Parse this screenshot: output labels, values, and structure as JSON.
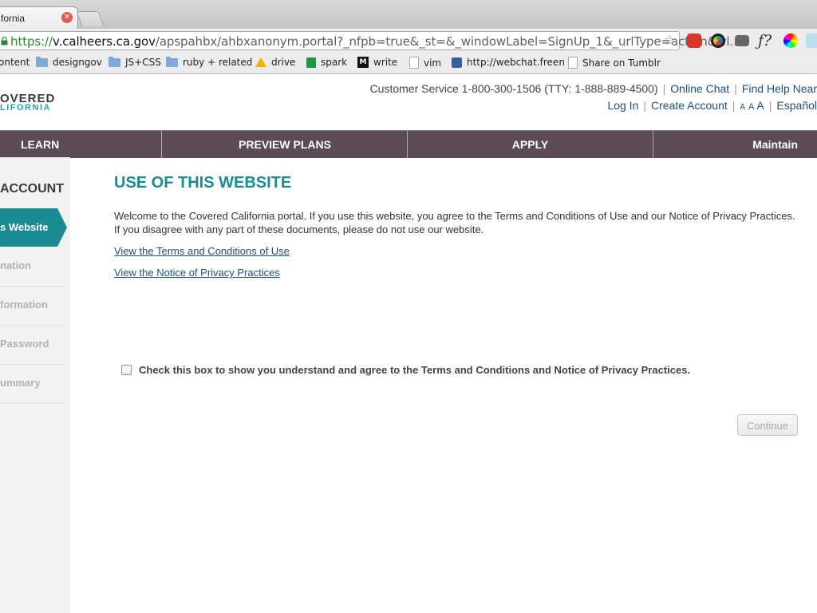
{
  "browser": {
    "tab_title": "fornia",
    "url_scheme": "https://",
    "url_host": "v.calheers.ca.gov",
    "url_rest": "/apspahbx/ahbxanonym.portal?_nfpb=true&_st=&_windowLabel=SignUp_1&_urlType=action&wl...",
    "bookmarks": [
      {
        "label": "ontent",
        "icon": "page-icon"
      },
      {
        "label": "designgov",
        "icon": "folder-icon"
      },
      {
        "label": "JS+CSS",
        "icon": "folder-icon"
      },
      {
        "label": "ruby + related",
        "icon": "folder-icon"
      },
      {
        "label": "drive",
        "icon": "drive-icon"
      },
      {
        "label": "spark",
        "icon": "sheet-icon"
      },
      {
        "label": "write",
        "icon": "medium-icon"
      },
      {
        "label": "vim",
        "icon": "page-icon"
      },
      {
        "label": "http://webchat.freen",
        "icon": "chat-icon"
      },
      {
        "label": "Share on Tumblr",
        "icon": "page-icon"
      }
    ]
  },
  "header": {
    "logo_line1": "OVERED",
    "logo_line2": "LIFORNIA",
    "customer_service": "Customer Service 1-800-300-1506 (TTY: 1-888-889-4500)",
    "online_chat": "Online Chat",
    "find_help": "Find Help Near",
    "log_in": "Log In",
    "create_account": "Create Account",
    "text_size": "A A A",
    "espanol": "Español"
  },
  "nav": {
    "learn": "LEARN",
    "preview_plans": "PREVIEW PLANS",
    "apply": "APPLY",
    "maintain": "Maintain"
  },
  "sidebar": {
    "title": "ACCOUNT",
    "active": "s Website",
    "items": [
      "nation",
      "formation",
      "Password",
      "ummary"
    ]
  },
  "main": {
    "title": "USE OF THIS WEBSITE",
    "intro": "Welcome to the Covered California portal. If you use this website, you agree to the Terms and Conditions of Use and our Notice of Privacy Practices. If you disagree with any part of these documents, please do not use our website.",
    "terms_link": "View the Terms and Conditions of Use",
    "privacy_link": "View the Notice of Privacy Practices",
    "agree_label": "Check this box to show you understand and agree to the Terms and Conditions and Notice of Privacy Practices.",
    "continue_label": "Continue"
  },
  "colors": {
    "accent": "#1a8a93",
    "nav_bg": "#5a4b55",
    "link": "#1d4d84"
  }
}
